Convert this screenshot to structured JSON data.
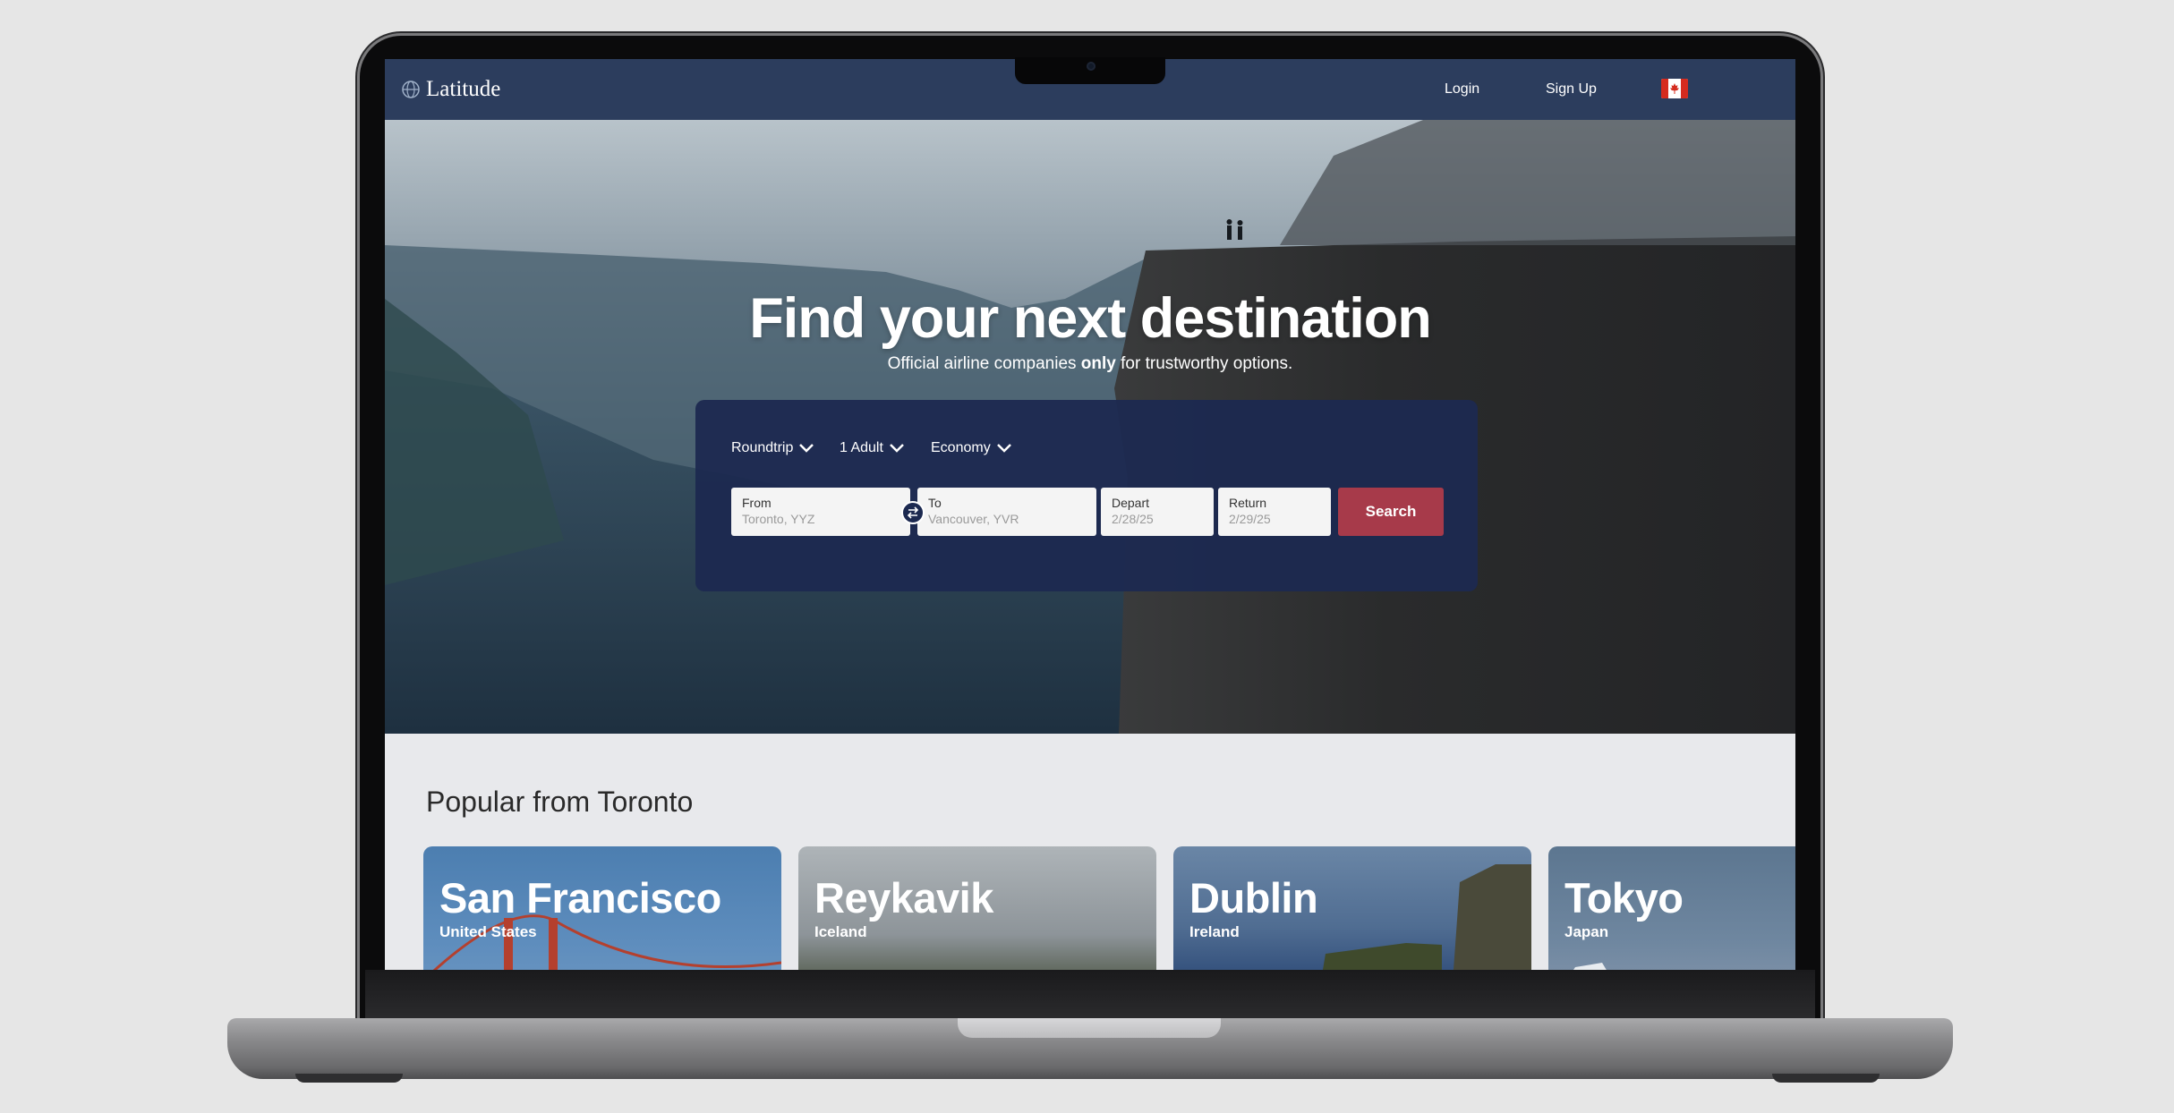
{
  "nav": {
    "brand": "Latitude",
    "login": "Login",
    "signup": "Sign Up",
    "flag_icon": "canada-flag-icon"
  },
  "hero": {
    "title": "Find your next destination",
    "subtitle_pre": "Official airline companies ",
    "subtitle_bold": "only",
    "subtitle_post": " for trustworthy options."
  },
  "search": {
    "trip_type": "Roundtrip",
    "passengers": "1 Adult",
    "cabin": "Economy",
    "from_label": "From",
    "from_placeholder": "Toronto, YYZ",
    "to_label": "To",
    "to_placeholder": "Vancouver, YVR",
    "depart_label": "Depart",
    "depart_placeholder": "2/28/25",
    "return_label": "Return",
    "return_placeholder": "2/29/25",
    "button": "Search"
  },
  "popular": {
    "title": "Popular from Toronto",
    "cards": [
      {
        "city": "San Francisco",
        "country": "United States"
      },
      {
        "city": "Reykavik",
        "country": "Iceland"
      },
      {
        "city": "Dublin",
        "country": "Ireland"
      },
      {
        "city": "Tokyo",
        "country": "Japan"
      }
    ]
  },
  "colors": {
    "nav": "#2c3d5d",
    "panel": "#1c2950",
    "search_button": "#a73a4a"
  }
}
